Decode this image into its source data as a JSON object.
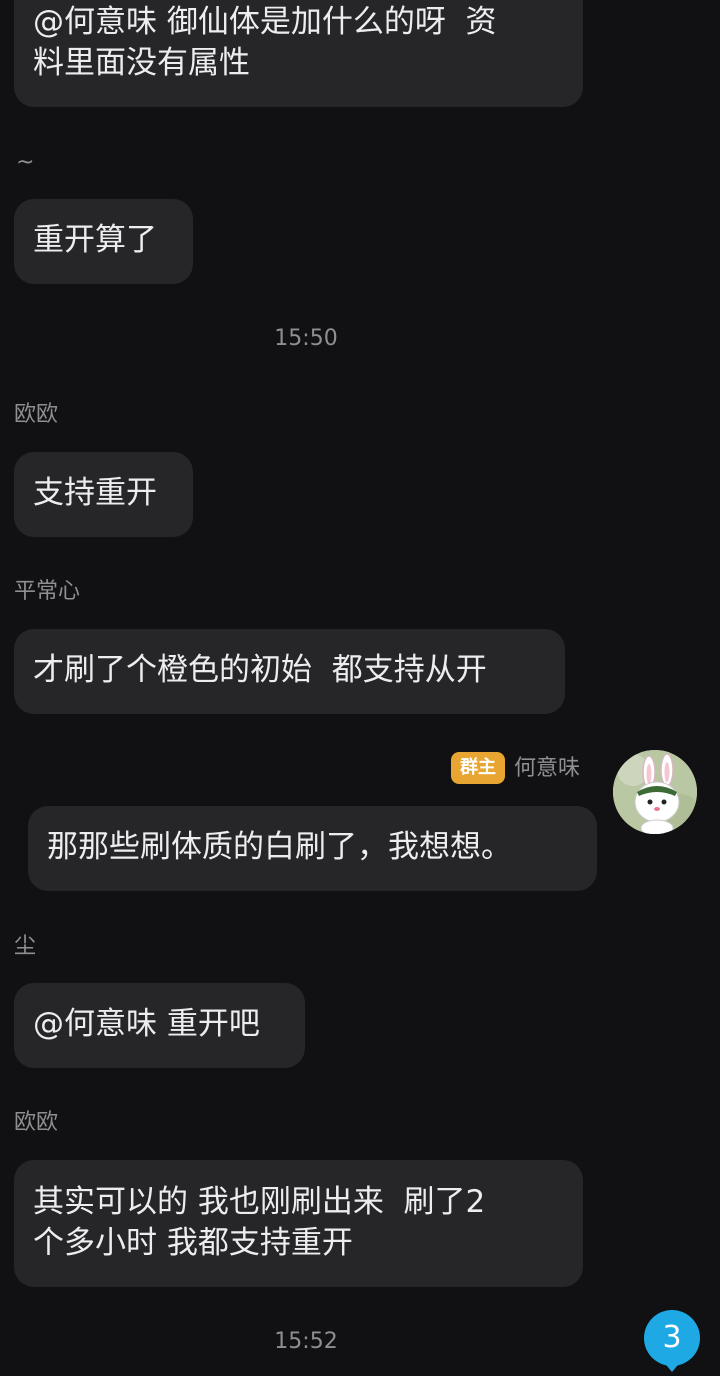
{
  "messages": [
    {
      "text": "@何意味 御仙体是加什么的呀  资\n料里面没有属性"
    },
    {
      "sender": "~",
      "text": "重开算了"
    },
    {
      "sender": "欧欧",
      "text": "支持重开"
    },
    {
      "sender": "平常心",
      "text": "才刷了个橙色的初始  都支持从开"
    },
    {
      "sender": "何意味",
      "badge": "群主",
      "text": "那那些刷体质的白刷了，我想想。"
    },
    {
      "sender": "尘",
      "text": "@何意味 重开吧"
    },
    {
      "sender": "欧欧",
      "text": "其实可以的 我也刚刷出来  刷了2\n个多小时 我都支持重开"
    }
  ],
  "timestamps": [
    "15:50",
    "15:52"
  ],
  "unread_count": "3",
  "colors": {
    "background": "#111113",
    "bubble": "#262628",
    "badge": "#e8a531",
    "unread": "#1fa9e4"
  },
  "icons": {
    "avatar": "rabbit-avatar"
  }
}
